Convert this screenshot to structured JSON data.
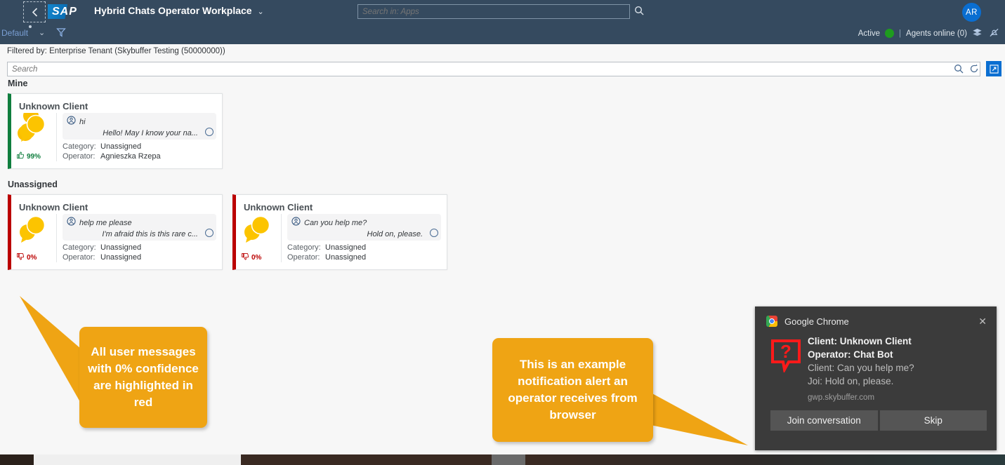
{
  "header": {
    "back_icon": "back-arrow-icon",
    "logo_text": "SAP",
    "app_title": "Hybrid Chats Operator Workplace",
    "app_title_chevron": "⌄",
    "search_placeholder": "Search in: Apps",
    "search_value": "",
    "search_icon": "search-icon",
    "avatar_initials": "AR",
    "variant_label": "Default",
    "variant_chevron": "⌄",
    "filter_icon": "filter-icon",
    "status_label": "Active",
    "status_color": "#1e9c1e",
    "separator": "|",
    "agents_online": "Agents online (0)",
    "layers_icon": "layers-icon",
    "mute_icon": "bell-off-icon"
  },
  "filterbar": {
    "filtered_by": "Filtered by: Enterprise Tenant (Skybuffer Testing (50000000))",
    "search_placeholder": "Search",
    "search_value": "",
    "search_icon": "search-icon",
    "refresh_icon": "refresh-icon",
    "expand_icon": "full-screen-icon"
  },
  "groups": [
    {
      "title": "Mine",
      "cards": [
        {
          "client": "Unknown Client",
          "accent": "#107e3e",
          "state": "ok",
          "confidence": "99%",
          "confidence_icon": "thumbs-up-icon",
          "avatar_icon": "chat-bubbles-icon",
          "incoming_icon": "person-icon",
          "incoming": "hi",
          "outgoing": "Hello! May I know your na...",
          "status_icon": "unread-circle-icon",
          "category_label": "Category:",
          "category_value": "Unassigned",
          "operator_label": "Operator:",
          "operator_value": "Agnieszka Rzepa"
        }
      ]
    },
    {
      "title": "Unassigned",
      "cards": [
        {
          "client": "Unknown Client",
          "accent": "#bb0000",
          "state": "bad",
          "confidence": "0%",
          "confidence_icon": "thumbs-down-icon",
          "avatar_icon": "chat-bubbles-icon",
          "incoming_icon": "person-icon",
          "incoming": "help me please",
          "outgoing": "I'm afraid this is this rare c...",
          "status_icon": "unread-circle-icon",
          "category_label": "Category:",
          "category_value": "Unassigned",
          "operator_label": "Operator:",
          "operator_value": "Unassigned"
        },
        {
          "client": "Unknown Client",
          "accent": "#bb0000",
          "state": "bad",
          "confidence": "0%",
          "confidence_icon": "thumbs-down-icon",
          "avatar_icon": "chat-bubbles-icon",
          "incoming_icon": "person-icon",
          "incoming": "Can you help me?",
          "outgoing": "Hold on, please.",
          "status_icon": "unread-circle-icon",
          "category_label": "Category:",
          "category_value": "Unassigned",
          "operator_label": "Operator:",
          "operator_value": "Unassigned"
        }
      ]
    }
  ],
  "callouts": {
    "color": "#efa414",
    "red_highlight": "All user messages with 0% confidence are  highlighted in red",
    "notification": "This is an example notification alert an operator receives from browser"
  },
  "chrome_notification": {
    "app_name": "Google Chrome",
    "chrome_icon": "chrome-logo-icon",
    "close_icon": "close-icon",
    "alert_icon": "question-mark-bubble-icon",
    "line1": "Client:  Unknown Client",
    "line2": "Operator:  Chat Bot",
    "line3": "Client: Can you help me?",
    "line4": "Joi: Hold on, please.",
    "origin": "gwp.skybuffer.com",
    "primary_button": "Join conversation",
    "secondary_button": "Skip"
  },
  "taskbar": {
    "clock": ""
  }
}
